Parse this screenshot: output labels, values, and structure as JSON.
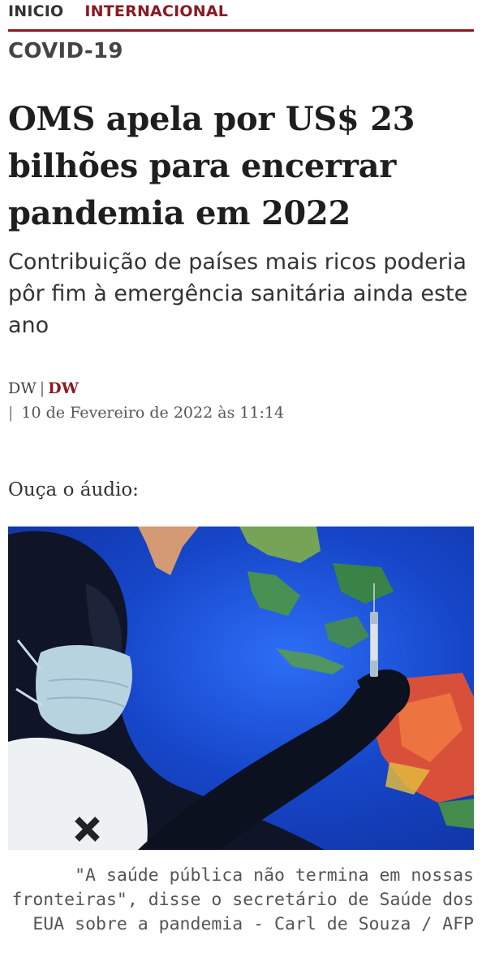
{
  "breadcrumb": {
    "home": "INICIO",
    "section": "INTERNACIONAL"
  },
  "section_label": "COVID-19",
  "article": {
    "headline": "OMS apela por US$ 23 bilhões para encerrar pandemia em 2022",
    "subtitle": "Contribuição de países mais ricos poderia pôr fim à emergência sanitária ainda este ano",
    "byline_author": "DW",
    "byline_separator": "|",
    "byline_source": "DW",
    "date_separator": "|",
    "date": "10 de Fevereiro de 2022 às 11:14",
    "audio_label": "Ouça o áudio:",
    "photo_icon": "vaccine-photo",
    "caption": "\"A saúde pública não termina em nossas fronteiras\", disse o secretário de Saúde dos EUA sobre a pandemia - Carl de Souza / AFP"
  },
  "colors": {
    "accent": "#8a1a22",
    "text": "#1e1e1e",
    "photo_blue": "#1646c8"
  }
}
